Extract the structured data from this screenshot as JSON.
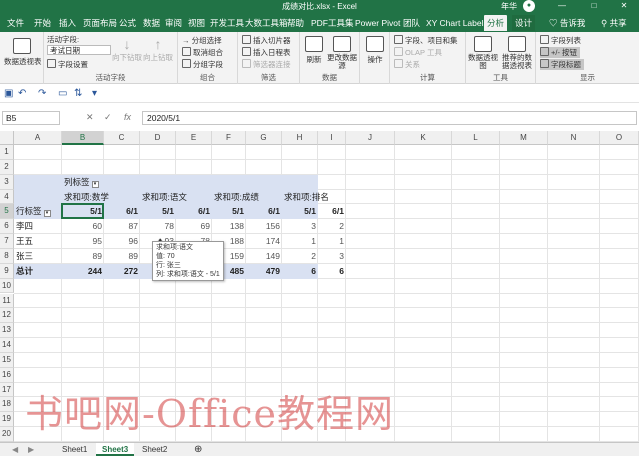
{
  "window": {
    "title": "成绩对比.xlsx - Excel",
    "user": "年华",
    "minimize": "—",
    "restore": "□",
    "close": "✕"
  },
  "tabs": [
    "文件",
    "开始",
    "插入",
    "页面布局",
    "公式",
    "数据",
    "审阅",
    "视图",
    "开发工具",
    "大数工具箱",
    "帮助",
    "PDF工具集",
    "Power Pivot",
    "团队",
    "XY Chart Labels",
    "分析",
    "设计"
  ],
  "active_tab": "分析",
  "tell_me": "告诉我",
  "share": "共享",
  "ribbon": {
    "pivot_table": "数据透视表",
    "active_field_label": "活动字段:",
    "active_field_value": "考试日期",
    "field_settings": "字段设置",
    "drill_down": "向下钻取",
    "drill_up": "向上钻取",
    "group_active_field": "活动字段",
    "group_selection": "分组选择",
    "ungroup": "取消组合",
    "group_field": "分组字段",
    "group_group": "组合",
    "insert_slicer": "插入切片器",
    "insert_timeline": "插入日程表",
    "filter_connections": "筛选器连接",
    "group_filter": "筛选",
    "refresh": "刷新",
    "change_source": "更改数据源",
    "group_data": "数据",
    "actions": "操作",
    "fields_items": "字段、项目和集",
    "olap": "OLAP 工具",
    "relationships": "关系",
    "group_calc": "计算",
    "pivot_chart": "数据透视图",
    "recommended": "推荐的数据透视表",
    "group_tools": "工具",
    "field_list": "字段列表",
    "buttons": "+/- 按钮",
    "field_headers": "字段标题",
    "group_show": "显示"
  },
  "formula_bar": {
    "name_box": "B5",
    "cancel": "✕",
    "confirm": "✓",
    "fx": "fx",
    "value": "2020/5/1"
  },
  "columns": [
    "A",
    "B",
    "C",
    "D",
    "E",
    "F",
    "G",
    "H",
    "I",
    "J",
    "K",
    "L",
    "M",
    "N",
    "O"
  ],
  "rows": [
    "1",
    "2",
    "3",
    "4",
    "5",
    "6",
    "7",
    "8",
    "9",
    "10",
    "11",
    "12",
    "13",
    "14",
    "15",
    "16",
    "17",
    "18",
    "19",
    "20"
  ],
  "pivot": {
    "col_labels": "列标签",
    "row_labels": "行标签",
    "groups": [
      "求和项:数学",
      "求和项:语文",
      "求和项:成绩",
      "求和项:排名"
    ],
    "dates": [
      "5/1",
      "6/1",
      "5/1",
      "6/1",
      "5/1",
      "6/1",
      "5/1",
      "6/1"
    ],
    "data_rows": [
      {
        "name": "李四",
        "values": [
          "60",
          "87",
          "78",
          "69",
          "138",
          "156",
          "3",
          "2"
        ]
      },
      {
        "name": "王五",
        "values": [
          "95",
          "96",
          "93",
          "78",
          "188",
          "174",
          "1",
          "1"
        ]
      },
      {
        "name": "张三",
        "values": [
          "89",
          "89",
          "70",
          "",
          "159",
          "149",
          "2",
          "3"
        ]
      }
    ],
    "total_label": "总计",
    "totals": [
      "244",
      "272",
      "",
      "",
      "485",
      "479",
      "6",
      "6"
    ]
  },
  "tooltip": {
    "line1": "求和项:语文",
    "line2": "值: 70",
    "line3": "行: 张三",
    "line4": "列: 求和项:语文 - 5/1"
  },
  "watermark": "书吧网-Office教程网",
  "sheets": [
    "Sheet1",
    "Sheet3",
    "Sheet2"
  ],
  "active_sheet": "Sheet3",
  "colors": {
    "excel_green": "#217346",
    "pivot_header": "#d9e1f2"
  }
}
